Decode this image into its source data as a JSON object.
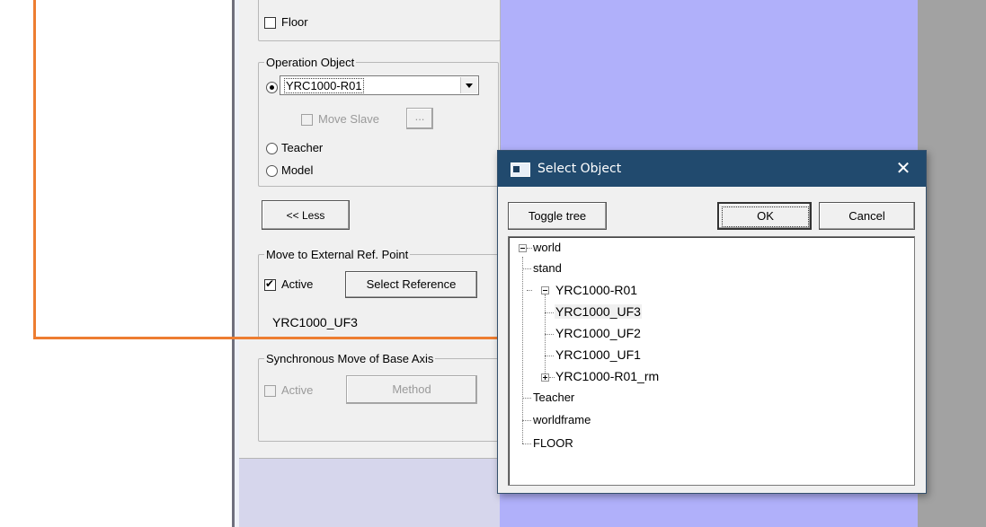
{
  "panel": {
    "floor_label": "Floor",
    "operation_object": {
      "legend": "Operation Object",
      "selected_robot": "YRC1000-R01",
      "move_slave_label": "Move Slave",
      "move_slave_button": "...",
      "teacher_label": "Teacher",
      "model_label": "Model"
    },
    "less_button": "<< Less",
    "external_ref": {
      "legend": "Move to External Ref. Point",
      "active_label": "Active",
      "select_reference_button": "Select Reference",
      "reference_value": "YRC1000_UF3"
    },
    "sync_move": {
      "legend": "Synchronous Move of Base Axis",
      "active_label": "Active",
      "method_button": "Method"
    }
  },
  "dialog": {
    "title": "Select Object",
    "close_glyph": "✕",
    "toggle_tree_button": "Toggle tree",
    "ok_button": "OK",
    "cancel_button": "Cancel",
    "tree": {
      "world": "world",
      "stand": "stand",
      "robot": "YRC1000-R01",
      "uf3": "YRC1000_UF3",
      "uf2": "YRC1000_UF2",
      "uf1": "YRC1000_UF1",
      "rm": "YRC1000-R01_rm",
      "teacher": "Teacher",
      "worldframe": "worldframe",
      "floor": "FLOOR"
    }
  },
  "annotation": {
    "color": "#ed7d31"
  },
  "icons": [
    "checkbox-icon",
    "radio-icon",
    "dropdown-arrow-icon",
    "window-icon",
    "close-icon",
    "collapse-icon",
    "expand-icon",
    "arrow-icon"
  ]
}
